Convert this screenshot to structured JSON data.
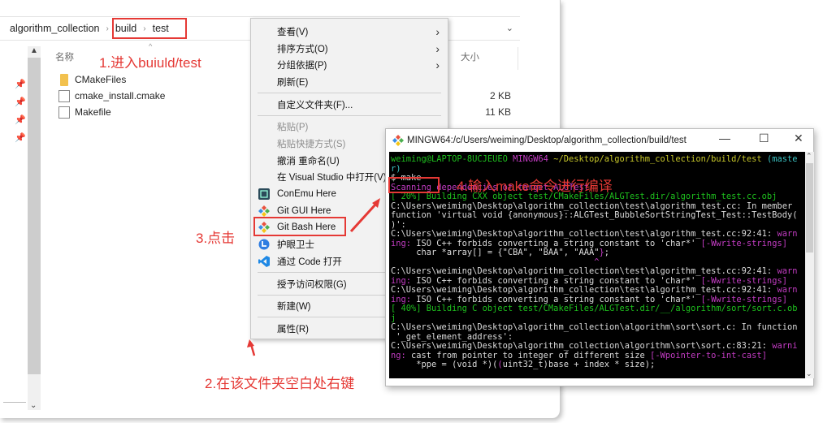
{
  "explorer": {
    "breadcrumb": [
      "algorithm_collection",
      "build",
      "test"
    ],
    "columns": {
      "name": "名称",
      "size": "大小"
    },
    "files": [
      {
        "name": "CMakeFiles",
        "type": "folder",
        "size": ""
      },
      {
        "name": "cmake_install.cmake",
        "type": "file",
        "size": "2 KB"
      },
      {
        "name": "Makefile",
        "type": "file",
        "size": "11 KB"
      }
    ]
  },
  "context_menu": {
    "items": [
      {
        "label": "查看(V)",
        "submenu": true
      },
      {
        "label": "排序方式(O)",
        "submenu": true
      },
      {
        "label": "分组依据(P)",
        "submenu": true
      },
      {
        "label": "刷新(E)"
      },
      {
        "label": "自定义文件夹(F)..."
      },
      {
        "label": "粘贴(P)",
        "disabled": true
      },
      {
        "label": "粘贴快捷方式(S)",
        "disabled": true
      },
      {
        "label": "撤消 重命名(U)"
      },
      {
        "label": "在 Visual Studio 中打开(V)"
      },
      {
        "label": "ConEmu Here",
        "icon": "conemu-icon"
      },
      {
        "label": "Git GUI Here",
        "icon": "git-icon"
      },
      {
        "label": "Git Bash Here",
        "icon": "git-icon"
      },
      {
        "label": "护眼卫士",
        "icon": "eye-care-icon"
      },
      {
        "label": "通过 Code 打开",
        "icon": "vscode-icon"
      },
      {
        "label": "授予访问权限(G)"
      },
      {
        "label": "新建(W)"
      },
      {
        "label": "属性(R)"
      }
    ]
  },
  "terminal": {
    "title": "MINGW64:/c/Users/weiming/Desktop/algorithm_collection/build/test",
    "controls": {
      "minimize": "—",
      "maximize": "☐",
      "close": "✕"
    },
    "lines": [
      [
        {
          "t": "weiming@LAPTOP-8UCJEUEO ",
          "c": "g"
        },
        {
          "t": "MINGW64 ",
          "c": "m"
        },
        {
          "t": "~/Desktop/algorithm_collection/build/test ",
          "c": "y"
        },
        {
          "t": "(maste",
          "c": "c"
        }
      ],
      [
        {
          "t": "r)",
          "c": "c"
        }
      ],
      [
        {
          "t": "$ make",
          "c": "w"
        }
      ],
      [
        {
          "t": "Scanning dependencies of target ALGTest",
          "c": "m"
        }
      ],
      [
        {
          "t": "[ 20%] Building CXX object test/CMakeFiles/ALGTest.dir/algorithm_test.cc.obj",
          "c": "g"
        }
      ],
      [
        {
          "t": "C:\\Users\\weiming\\Desktop\\algorithm_collection\\test\\algorithm_test.cc: In member",
          "c": "w"
        }
      ],
      [
        {
          "t": "function 'virtual void {anonymous}::ALGTest_BubbleSortStringTest_Test::TestBody(",
          "c": "w"
        }
      ],
      [
        {
          "t": ")':",
          "c": "w"
        }
      ],
      [
        {
          "t": "C:\\Users\\weiming\\Desktop\\algorithm_collection\\test\\algorithm_test.cc:92:41: ",
          "c": "w"
        },
        {
          "t": "warn",
          "c": "m"
        }
      ],
      [
        {
          "t": "ing: ",
          "c": "m"
        },
        {
          "t": "ISO C++ forbids converting a string constant to '",
          "c": "w"
        },
        {
          "t": "char*",
          "c": "w"
        },
        {
          "t": "' ",
          "c": "w"
        },
        {
          "t": "[-Wwrite-strings]",
          "c": "m"
        }
      ],
      [
        {
          "t": "     char *array[] = {\"CBA\", \"BAA\", \"AAA\"",
          "c": "w"
        },
        {
          "t": "}",
          "c": "m"
        },
        {
          "t": ";",
          "c": "w"
        }
      ],
      [
        {
          "t": "                                        ^",
          "c": "m"
        }
      ],
      [
        {
          "t": "C:\\Users\\weiming\\Desktop\\algorithm_collection\\test\\algorithm_test.cc:92:41: ",
          "c": "w"
        },
        {
          "t": "warn",
          "c": "m"
        }
      ],
      [
        {
          "t": "ing: ",
          "c": "m"
        },
        {
          "t": "ISO C++ forbids converting a string constant to 'char*' ",
          "c": "w"
        },
        {
          "t": "[-Wwrite-strings]",
          "c": "m"
        }
      ],
      [
        {
          "t": "C:\\Users\\weiming\\Desktop\\algorithm_collection\\test\\algorithm_test.cc:92:41: ",
          "c": "w"
        },
        {
          "t": "warn",
          "c": "m"
        }
      ],
      [
        {
          "t": "ing: ",
          "c": "m"
        },
        {
          "t": "ISO C++ forbids converting a string constant to 'char*' ",
          "c": "w"
        },
        {
          "t": "[-Wwrite-strings]",
          "c": "m"
        }
      ],
      [
        {
          "t": "[ 40%] Building C object test/CMakeFiles/ALGTest.dir/__/algorithm/sort/sort.c.ob",
          "c": "g"
        }
      ],
      [
        {
          "t": "j",
          "c": "g"
        }
      ],
      [
        {
          "t": "C:\\Users\\weiming\\Desktop\\algorithm_collection\\algorithm\\sort\\sort.c: In function",
          "c": "w"
        }
      ],
      [
        {
          "t": " '_get_element_address':",
          "c": "w"
        }
      ],
      [
        {
          "t": "C:\\Users\\weiming\\Desktop\\algorithm_collection\\algorithm\\sort\\sort.c:83:21: ",
          "c": "w"
        },
        {
          "t": "warni",
          "c": "m"
        }
      ],
      [
        {
          "t": "ng: ",
          "c": "m"
        },
        {
          "t": "cast from pointer to integer of different size ",
          "c": "w"
        },
        {
          "t": "[-Wpointer-to-int-cast]",
          "c": "m"
        }
      ],
      [
        {
          "t": "     *ppe = (void *)(",
          "c": "w"
        },
        {
          "t": "(",
          "c": "m"
        },
        {
          "t": "uint32_t)base + index * size);",
          "c": "w"
        }
      ]
    ]
  },
  "annotations": {
    "step1": "1.进入buiuld/test",
    "step2": "2.在该文件夹空白处右键",
    "step3": "3.点击",
    "step4": "4.输入make命令进行编译"
  },
  "colors": {
    "annotation": "#e53935",
    "terminal_bg": "#000000"
  }
}
